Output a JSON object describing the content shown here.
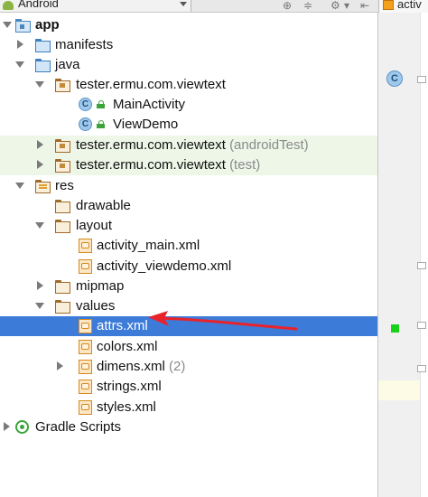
{
  "toolbar": {
    "view_label": "Android",
    "editor_tab_label": "activ"
  },
  "tree": {
    "app": "app",
    "manifests": "manifests",
    "java": "java",
    "package_main": "tester.ermu.com.viewtext",
    "main_activity": "MainActivity",
    "view_demo": "ViewDemo",
    "package_android_test": "tester.ermu.com.viewtext",
    "package_android_test_suffix": "(androidTest)",
    "package_test": "tester.ermu.com.viewtext",
    "package_test_suffix": "(test)",
    "res": "res",
    "drawable": "drawable",
    "layout": "layout",
    "activity_main_xml": "activity_main.xml",
    "activity_viewdemo_xml": "activity_viewdemo.xml",
    "mipmap": "mipmap",
    "values": "values",
    "attrs_xml": "attrs.xml",
    "colors_xml": "colors.xml",
    "dimens_xml": "dimens.xml",
    "dimens_xml_suffix": "(2)",
    "strings_xml": "strings.xml",
    "styles_xml": "styles.xml",
    "gradle_scripts": "Gradle Scripts"
  },
  "gutter": {
    "class_letter": "C"
  },
  "icon_letters": {
    "class": "C"
  },
  "colors": {
    "selection": "#3d7bd9",
    "test_highlight": "#eef6e8",
    "annotation_arrow": "#e8232a",
    "gutter_marker": "#19d119"
  }
}
